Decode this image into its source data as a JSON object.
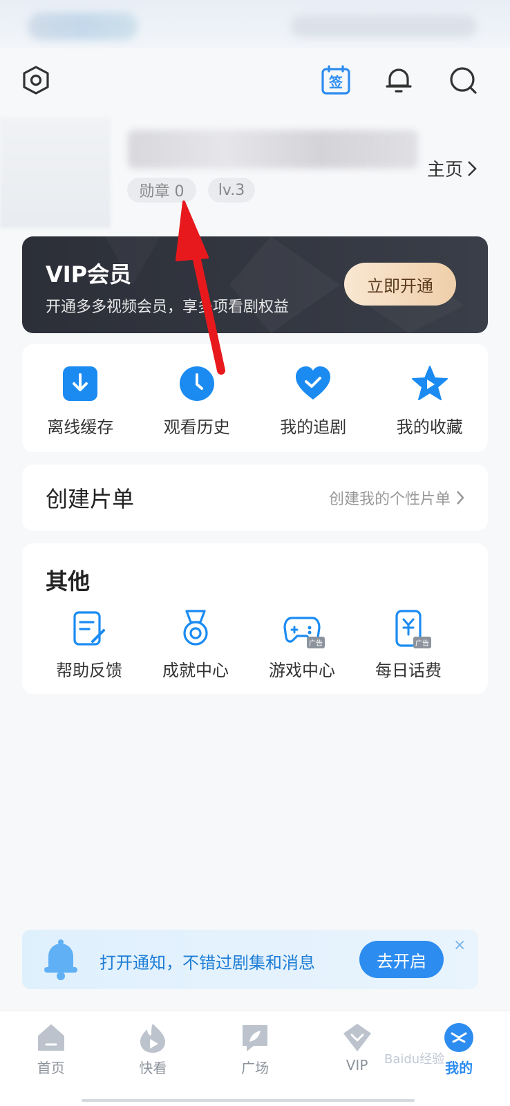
{
  "topbar": {
    "settings_icon": "gear-hexagon-icon",
    "sign_in_label": "签",
    "message_icon": "bell-icon",
    "search_icon": "search-icon"
  },
  "profile": {
    "homepage_link": "主页",
    "badge_label": "勋章 0",
    "level_label": "lv.3"
  },
  "vip": {
    "title": "VIP会员",
    "subtitle": "开通多多视频会员，享多项看剧权益",
    "button": "立即开通"
  },
  "quick_actions": [
    {
      "label": "离线缓存",
      "icon": "download-icon"
    },
    {
      "label": "观看历史",
      "icon": "clock-icon"
    },
    {
      "label": "我的追剧",
      "icon": "heart-icon"
    },
    {
      "label": "我的收藏",
      "icon": "star-play-icon"
    }
  ],
  "playlist": {
    "title": "创建片单",
    "link": "创建我的个性片单"
  },
  "others": {
    "title": "其他",
    "items": [
      {
        "label": "帮助反馈",
        "icon": "feedback-icon"
      },
      {
        "label": "成就中心",
        "icon": "medal-icon"
      },
      {
        "label": "游戏中心",
        "icon": "gamepad-icon",
        "ad": "广告"
      },
      {
        "label": "每日话费",
        "icon": "phone-yuan-icon",
        "ad": "广告"
      }
    ]
  },
  "notify": {
    "text": "打开通知，不错过剧集和消息",
    "button": "去开启",
    "close": "×"
  },
  "tabs": [
    {
      "label": "首页",
      "icon": "home-icon"
    },
    {
      "label": "快看",
      "icon": "flame-play-icon"
    },
    {
      "label": "广场",
      "icon": "leaf-icon"
    },
    {
      "label": "VIP",
      "icon": "vip-diamond-icon"
    },
    {
      "label": "我的",
      "icon": "profile-icon",
      "active": true
    }
  ],
  "watermark": "Baidu经验",
  "colors": {
    "accent": "#2d8cf0",
    "vip_bg": "#2c2f38",
    "annotation_arrow": "#e8191c"
  }
}
